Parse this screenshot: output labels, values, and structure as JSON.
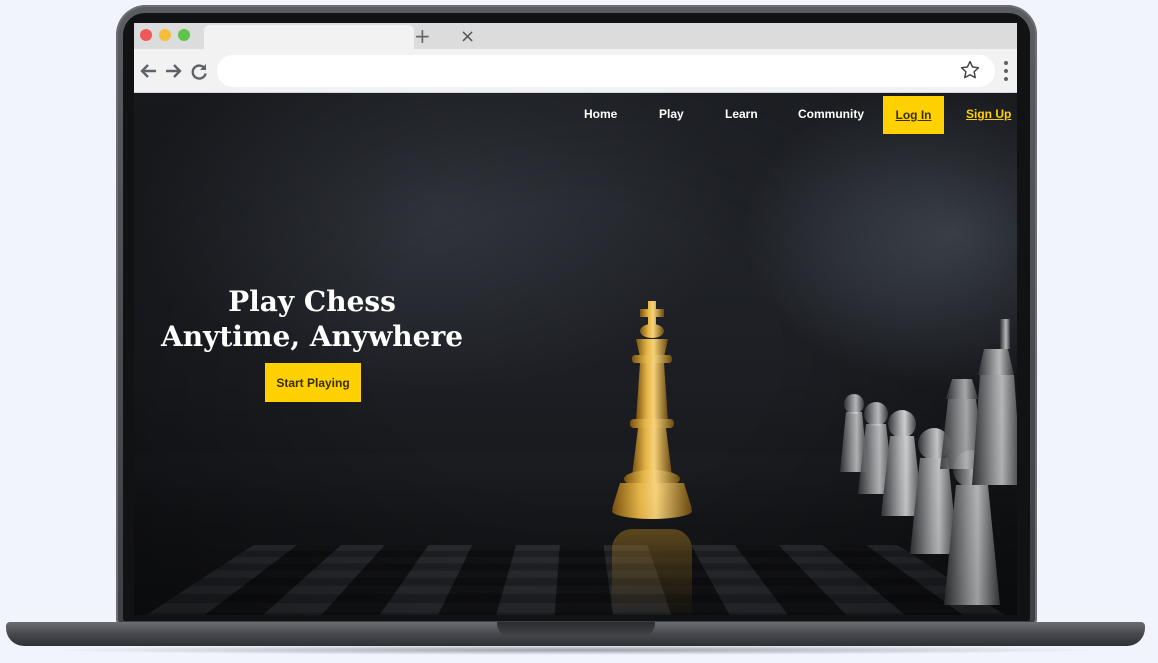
{
  "browser": {
    "tab_close_glyph": "×",
    "new_tab_glyph": "+",
    "back_icon": "arrow-left-icon",
    "forward_icon": "arrow-right-icon",
    "reload_icon": "reload-icon",
    "bookmark_icon": "star-icon",
    "menu_icon": "kebab-menu-icon",
    "url": ""
  },
  "site": {
    "nav": {
      "home": "Home",
      "play": "Play",
      "learn": "Learn",
      "community": "Community",
      "login": "Log In",
      "signup": "Sign Up"
    },
    "hero": {
      "title_line1": "Play Chess",
      "title_line2": "Anytime, Anywhere",
      "cta": "Start Playing"
    }
  },
  "colors": {
    "accent": "#ffd100",
    "page_background": "#f1f4fd",
    "hero_dark": "#1c1e23"
  }
}
